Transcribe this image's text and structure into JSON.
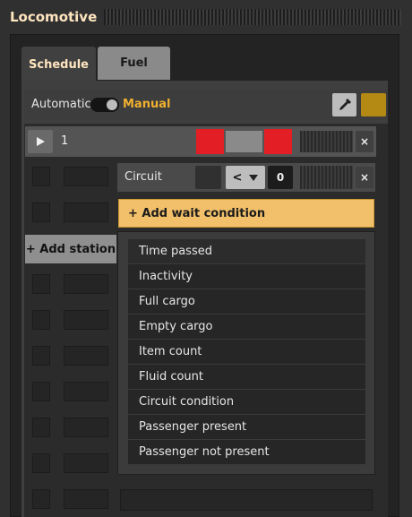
{
  "window": {
    "title": "Locomotive"
  },
  "tabs": [
    {
      "label": "Schedule",
      "active": true
    },
    {
      "label": "Fuel",
      "active": false
    }
  ],
  "mode": {
    "automatic_label": "Automatic",
    "manual_label": "Manual",
    "state": "Manual"
  },
  "toolbar": {
    "color_picker_icon": "eyedropper-icon",
    "color_swatch": "#b58a14"
  },
  "schedule": {
    "stations": [
      {
        "name": "1",
        "status_colors": [
          "#e31e24",
          "#8a8a8a",
          "#e31e24"
        ],
        "conditions": [
          {
            "type": "Circuit",
            "comparator": "<",
            "value": "0"
          }
        ]
      }
    ],
    "add_wait_label": "+ Add wait condition",
    "add_station_label": "+ Add station"
  },
  "wait_condition_menu": {
    "items": [
      "Time passed",
      "Inactivity",
      "Full cargo",
      "Empty cargo",
      "Item count",
      "Fluid count",
      "Circuit condition",
      "Passenger present",
      "Passenger not present"
    ]
  },
  "icons": {
    "close": "×",
    "play": "▶",
    "dropdown": "▼"
  }
}
